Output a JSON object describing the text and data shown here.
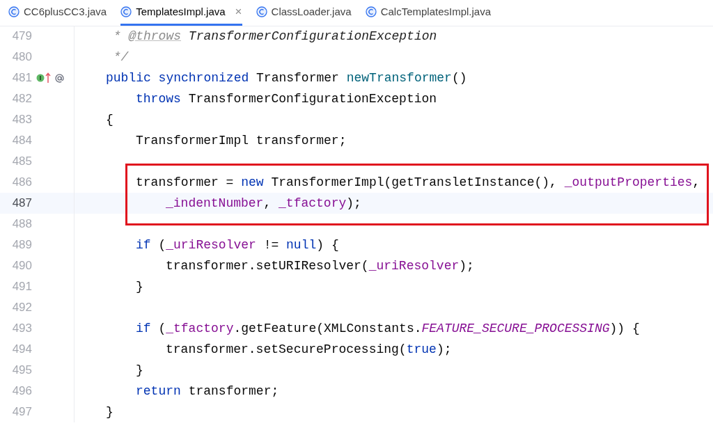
{
  "tabs": [
    {
      "label": "CC6plusCC3.java",
      "selected": false,
      "closable": false
    },
    {
      "label": "TemplatesImpl.java",
      "selected": true,
      "closable": true,
      "close": "×"
    },
    {
      "label": "ClassLoader.java",
      "selected": false,
      "closable": false
    },
    {
      "label": "CalcTemplatesImpl.java",
      "selected": false,
      "closable": false
    }
  ],
  "lines": [
    {
      "number": "479",
      "kind": "outer",
      "tokens": [
        {
          "text": " * ",
          "kind": "comment"
        },
        {
          "text": "@throws",
          "kind": "doctag"
        },
        {
          "text": " TransformerConfigurationException",
          "kind": "doc"
        }
      ]
    },
    {
      "number": "480",
      "kind": "outer",
      "tokens": [
        {
          "text": " */",
          "kind": "comment"
        }
      ]
    },
    {
      "number": "481",
      "kind": "outer",
      "markers": [
        {
          "kind": "implements"
        },
        {
          "kind": "overrides"
        },
        {
          "kind": "annotation"
        }
      ],
      "tokens": [
        {
          "text": "public synchronized ",
          "kind": "keyword"
        },
        {
          "text": "Transformer ",
          "kind": "plain"
        },
        {
          "text": "newTransformer",
          "kind": "decl"
        },
        {
          "text": "()",
          "kind": "plain"
        }
      ]
    },
    {
      "number": "482",
      "kind": "body",
      "tokens": [
        {
          "text": "throws ",
          "kind": "keyword"
        },
        {
          "text": "TransformerConfigurationException",
          "kind": "plain"
        }
      ]
    },
    {
      "number": "483",
      "kind": "outer",
      "tokens": [
        {
          "text": "{",
          "kind": "plain"
        }
      ]
    },
    {
      "number": "484",
      "kind": "body",
      "tokens": [
        {
          "text": "TransformerImpl transformer;",
          "kind": "plain"
        }
      ]
    },
    {
      "number": "485",
      "kind": "outer"
    },
    {
      "number": "486",
      "kind": "body",
      "boxed": true,
      "tokens": [
        {
          "text": "transformer = ",
          "kind": "plain"
        },
        {
          "text": "new ",
          "kind": "keyword"
        },
        {
          "text": "TransformerImpl(getTransletInstance(), ",
          "kind": "plain"
        },
        {
          "text": "_outputProperties",
          "kind": "field"
        },
        {
          "text": ",",
          "kind": "plain"
        }
      ]
    },
    {
      "number": "487",
      "kind": "inner",
      "boxed": true,
      "current": true,
      "tokens": [
        {
          "text": "_indentNumber",
          "kind": "field"
        },
        {
          "text": ", ",
          "kind": "plain"
        },
        {
          "text": "_tfactory",
          "kind": "field"
        },
        {
          "text": ");",
          "kind": "plain"
        }
      ]
    },
    {
      "number": "488",
      "kind": "outer"
    },
    {
      "number": "489",
      "kind": "body",
      "tokens": [
        {
          "text": "if ",
          "kind": "keyword"
        },
        {
          "text": "(",
          "kind": "plain"
        },
        {
          "text": "_uriResolver",
          "kind": "field"
        },
        {
          "text": " != ",
          "kind": "plain"
        },
        {
          "text": "null",
          "kind": "keyword"
        },
        {
          "text": ") {",
          "kind": "plain"
        }
      ]
    },
    {
      "number": "490",
      "kind": "inner",
      "tokens": [
        {
          "text": "transformer.setURIResolver(",
          "kind": "plain"
        },
        {
          "text": "_uriResolver",
          "kind": "field"
        },
        {
          "text": ");",
          "kind": "plain"
        }
      ]
    },
    {
      "number": "491",
      "kind": "body",
      "tokens": [
        {
          "text": "}",
          "kind": "plain"
        }
      ]
    },
    {
      "number": "492",
      "kind": "outer"
    },
    {
      "number": "493",
      "kind": "body",
      "tokens": [
        {
          "text": "if ",
          "kind": "keyword"
        },
        {
          "text": "(",
          "kind": "plain"
        },
        {
          "text": "_tfactory",
          "kind": "field"
        },
        {
          "text": ".getFeature(XMLConstants.",
          "kind": "plain"
        },
        {
          "text": "FEATURE_SECURE_PROCESSING",
          "kind": "constant"
        },
        {
          "text": ")) {",
          "kind": "plain"
        }
      ]
    },
    {
      "number": "494",
      "kind": "inner",
      "tokens": [
        {
          "text": "transformer.setSecureProcessing(",
          "kind": "plain"
        },
        {
          "text": "true",
          "kind": "keyword"
        },
        {
          "text": ");",
          "kind": "plain"
        }
      ]
    },
    {
      "number": "495",
      "kind": "body",
      "tokens": [
        {
          "text": "}",
          "kind": "plain"
        }
      ]
    },
    {
      "number": "496",
      "kind": "body",
      "tokens": [
        {
          "text": "return ",
          "kind": "keyword"
        },
        {
          "text": "transformer;",
          "kind": "plain"
        }
      ]
    },
    {
      "number": "497",
      "kind": "outer",
      "tokens": [
        {
          "text": "}",
          "kind": "plain"
        }
      ]
    }
  ]
}
